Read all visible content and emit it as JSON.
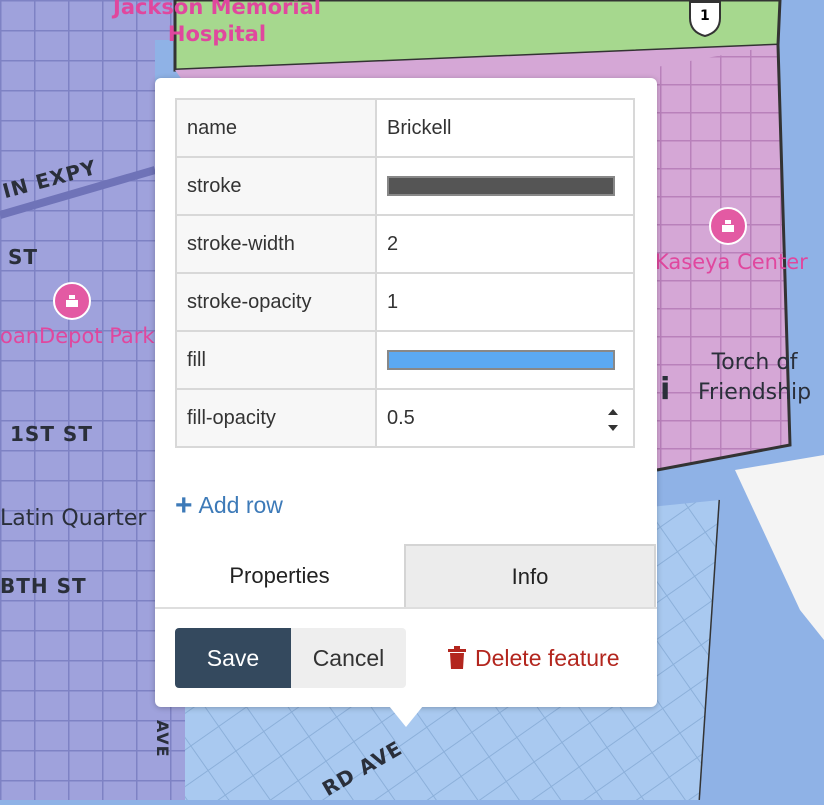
{
  "map": {
    "labels": {
      "hospital": "Jackson Memorial\nHospital",
      "expy": "IN EXPY",
      "st": "ST",
      "park": "oanDepot Park",
      "first_st": "1ST ST",
      "latin_quarter": "Latin Quarter",
      "eighth_st": "BTH ST",
      "kaseya": "Kaseya Center",
      "torch": "Torch of\nFriendship",
      "ave_vertical": "AVE",
      "rd_ave": "RD AVE",
      "shield_number": "1"
    },
    "colors": {
      "water": "#8fb2e6",
      "west_region": "#9fa2dc",
      "north_region": "#a6d88e",
      "east_region": "#d5a7d6",
      "south_region": "#a9c9f0",
      "border": "#333333"
    }
  },
  "popup": {
    "properties": [
      {
        "key": "name",
        "value": "Brickell",
        "type": "text"
      },
      {
        "key": "stroke",
        "value": "#555555",
        "type": "color"
      },
      {
        "key": "stroke-width",
        "value": "2",
        "type": "text"
      },
      {
        "key": "stroke-opacity",
        "value": "1",
        "type": "text"
      },
      {
        "key": "fill",
        "value": "#5ba9f2",
        "type": "color"
      },
      {
        "key": "fill-opacity",
        "value": "0.5",
        "type": "number"
      }
    ],
    "add_row_label": "Add row",
    "tabs": {
      "properties": "Properties",
      "info": "Info"
    },
    "buttons": {
      "save": "Save",
      "cancel": "Cancel",
      "delete": "Delete feature"
    }
  }
}
